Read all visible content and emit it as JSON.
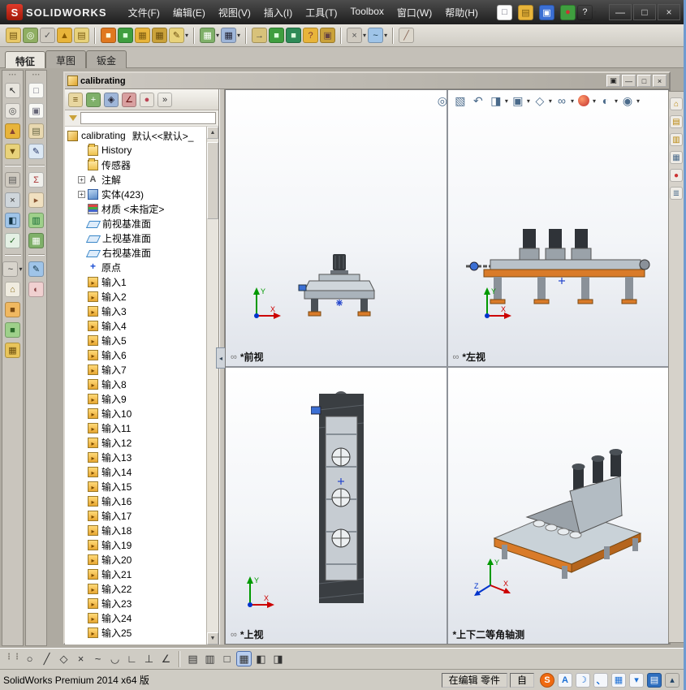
{
  "titlebar": {
    "logo_letter": "S",
    "brand": "SOLIDWORKS",
    "menus": [
      "文件(F)",
      "编辑(E)",
      "视图(V)",
      "插入(I)",
      "工具(T)",
      "Toolbox",
      "窗口(W)",
      "帮助(H)"
    ],
    "tools": [
      {
        "name": "new-document-icon",
        "glyph": "□",
        "bg": "#fdfdfd",
        "fg": "#667",
        "dd": true
      },
      {
        "name": "open-document-icon",
        "glyph": "▤",
        "bg": "#e8b43a",
        "fg": "#7a5a10",
        "dd": true
      },
      {
        "name": "save-icon",
        "glyph": "▣",
        "bg": "#3b6fd4",
        "fg": "#fff",
        "dd": true
      },
      {
        "name": "rebuild-traffic-icon",
        "glyph": "●",
        "bg": "#3f9e3f",
        "fg": "#c33"
      },
      {
        "name": "help-icon",
        "glyph": "?",
        "bg": "transparent",
        "fg": "#eee",
        "dd": true
      }
    ],
    "window_buttons": [
      {
        "name": "app-minimize-button",
        "glyph": "—"
      },
      {
        "name": "app-maximize-button",
        "glyph": "□"
      },
      {
        "name": "app-close-button",
        "glyph": "×"
      }
    ]
  },
  "toolbar2": {
    "items": [
      {
        "name": "print-icon",
        "glyph": "▤",
        "bg": "#e9c867",
        "fg": "#6b4e0e"
      },
      {
        "name": "print-preview-icon",
        "glyph": "◎",
        "bg": "#8fae62",
        "fg": "#fff"
      },
      {
        "name": "spell-check-icon",
        "glyph": "✓",
        "bg": "#cfcac0",
        "fg": "#555"
      },
      {
        "name": "alert-bell-icon",
        "glyph": "▲",
        "bg": "#e8b43a",
        "fg": "#8a5a00"
      },
      {
        "name": "mail-icon",
        "glyph": "▤",
        "bg": "#e8d27a",
        "fg": "#7a5a10"
      },
      {
        "sep": true
      },
      {
        "name": "toolbox-part-1-icon",
        "glyph": "■",
        "bg": "#e07820",
        "fg": "#ffd"
      },
      {
        "name": "toolbox-part-2-icon",
        "glyph": "■",
        "bg": "#3f9e3f",
        "fg": "#dfd"
      },
      {
        "name": "toolbox-part-3-icon",
        "glyph": "▦",
        "bg": "#e8b43a",
        "fg": "#7a5a10"
      },
      {
        "name": "toolbox-part-4-icon",
        "glyph": "▦",
        "bg": "#caa23a",
        "fg": "#6b4e0e"
      },
      {
        "name": "edit-definition-icon",
        "glyph": "✎",
        "bg": "#e8d27a",
        "fg": "#6b4e0e",
        "dd": true
      },
      {
        "sep": true
      },
      {
        "name": "pattern-grid-icon",
        "glyph": "▦",
        "bg": "#7fb069",
        "fg": "#fff",
        "dd": true
      },
      {
        "name": "design-table-icon",
        "glyph": "▦",
        "bg": "#9fb6d9",
        "fg": "#223",
        "dd": true
      },
      {
        "sep": true
      },
      {
        "name": "import-icon",
        "glyph": "→",
        "bg": "#d8c27a",
        "fg": "#444"
      },
      {
        "name": "export-step-icon",
        "glyph": "■",
        "bg": "#3f9e3f",
        "fg": "#dfd"
      },
      {
        "name": "export-iges-icon",
        "glyph": "■",
        "bg": "#2e8b57",
        "fg": "#dfd"
      },
      {
        "name": "check-model-icon",
        "glyph": "?",
        "bg": "#e8b43a",
        "fg": "#733"
      },
      {
        "name": "lock-reference-icon",
        "glyph": "▣",
        "bg": "#caa23a",
        "fg": "#644"
      },
      {
        "sep": true
      },
      {
        "name": "options-icon",
        "glyph": "×",
        "bg": "#cfcac0",
        "fg": "#555",
        "dd": true
      },
      {
        "name": "spline-tools-icon",
        "glyph": "~",
        "bg": "#9fc4e8",
        "fg": "#134",
        "dd": true
      },
      {
        "sep": true
      },
      {
        "name": "measure-icon",
        "glyph": "╱",
        "bg": "#dcd7cc",
        "fg": "#865"
      }
    ]
  },
  "ribbon_tabs": {
    "items": [
      "特征",
      "草图",
      "钣金"
    ],
    "names": [
      "tab-features",
      "tab-sketch",
      "tab-sheetmetal"
    ],
    "active": 0
  },
  "left_rail": {
    "col1": [
      {
        "name": "select-cursor-icon",
        "glyph": "↖",
        "bg": "#e8e5de",
        "fg": "#222"
      },
      {
        "name": "zoom-tool-icon",
        "glyph": "◎",
        "bg": "#e8e5de",
        "fg": "#444"
      },
      {
        "name": "alert-icon",
        "glyph": "▲",
        "bg": "#e8b43a",
        "fg": "#843"
      },
      {
        "name": "filter-tree-icon",
        "glyph": "▼",
        "bg": "#e8d27a",
        "fg": "#6b4e0e"
      },
      {
        "sep": true
      },
      {
        "name": "layers-icon",
        "glyph": "▤",
        "bg": "#cfcac0",
        "fg": "#555"
      },
      {
        "name": "cut-sketch-icon",
        "glyph": "×",
        "bg": "#cfd6db",
        "fg": "#333"
      },
      {
        "name": "paint-appearance-icon",
        "glyph": "◧",
        "bg": "#9fc4e8",
        "fg": "#134"
      },
      {
        "name": "verify-icon",
        "glyph": "✓",
        "bg": "#e4f0e4",
        "fg": "#2a6a2a"
      },
      {
        "sep": true
      },
      {
        "name": "magnet-snap-icon",
        "glyph": "~",
        "bg": "#d8d4cc",
        "fg": "#333",
        "dd": true
      },
      {
        "name": "home-view-icon",
        "glyph": "⌂",
        "bg": "#f0ece0",
        "fg": "#8a6a1a"
      },
      {
        "name": "orange-part-icon",
        "glyph": "■",
        "bg": "#f0b860",
        "fg": "#7a4a12"
      },
      {
        "name": "green-part-icon",
        "glyph": "■",
        "bg": "#9ed08a",
        "fg": "#2a6a2a"
      },
      {
        "name": "pattern-gold-icon",
        "glyph": "▦",
        "bg": "#e8c45a",
        "fg": "#6b4e0e"
      }
    ],
    "col2": [
      {
        "name": "sheet-icon",
        "glyph": "□",
        "bg": "#f8f8f4",
        "fg": "#667"
      },
      {
        "name": "sheet-copy-icon",
        "glyph": "▣",
        "bg": "#f8f8f4",
        "fg": "#667"
      },
      {
        "name": "clipboard-icon",
        "glyph": "▤",
        "bg": "#e8d8b0",
        "fg": "#664"
      },
      {
        "name": "edit-note-icon",
        "glyph": "✎",
        "bg": "#dce8f4",
        "fg": "#236"
      },
      {
        "sep": true
      },
      {
        "name": "equations-icon",
        "glyph": "Σ",
        "bg": "#f0f0ec",
        "fg": "#a33"
      },
      {
        "name": "bookmark-icon",
        "glyph": "▸",
        "bg": "#f0e0c0",
        "fg": "#853"
      },
      {
        "name": "green-book-icon",
        "glyph": "▥",
        "bg": "#9ed08a",
        "fg": "#163"
      },
      {
        "name": "green-book2-icon",
        "glyph": "▦",
        "bg": "#7fb069",
        "fg": "#fff"
      },
      {
        "sep": true
      },
      {
        "name": "blue-brush-icon",
        "glyph": "✎",
        "bg": "#9fc4e8",
        "fg": "#134"
      },
      {
        "name": "palette-icon",
        "glyph": "◐",
        "bg": "#f0d0d0",
        "fg": "#844"
      }
    ]
  },
  "document": {
    "title": "calibrating",
    "buttons": [
      {
        "name": "doc-restore-button",
        "glyph": "▣"
      },
      {
        "name": "doc-minimize-button",
        "glyph": "—"
      },
      {
        "name": "doc-maximize-button",
        "glyph": "□"
      },
      {
        "name": "doc-close-button",
        "glyph": "×"
      }
    ]
  },
  "feature_manager": {
    "tabs": [
      {
        "name": "featuremanager-tab",
        "glyph": "≡",
        "bg": "#e8d7a0",
        "fg": "#6b4e0e"
      },
      {
        "name": "propertymanager-tab",
        "glyph": "+",
        "bg": "#7fb069",
        "fg": "#fff"
      },
      {
        "name": "configurationmanager-tab",
        "glyph": "◈",
        "bg": "#9fb6d9",
        "fg": "#223"
      },
      {
        "name": "dimxpertmanager-tab",
        "glyph": "∠",
        "bg": "#d9a0a0",
        "fg": "#611"
      },
      {
        "name": "displaymanager-tab",
        "glyph": "●",
        "bg": "#e8e4dc",
        "fg": "#b45"
      },
      {
        "name": "fm-tabs-overflow-button",
        "glyph": "»",
        "bg": "transparent",
        "fg": "#333"
      }
    ],
    "filter_value": "",
    "tree": {
      "root_label": "calibrating",
      "root_config": "默认<<默认>_",
      "items": [
        {
          "label": "History",
          "icon": "history"
        },
        {
          "label": "传感器",
          "icon": "sensors"
        },
        {
          "label": "注解",
          "icon": "annotations",
          "expand": true
        },
        {
          "label": "实体(423)",
          "icon": "solids",
          "expand": true
        },
        {
          "label": "材质 <未指定>",
          "icon": "material"
        },
        {
          "label": "前视基准面",
          "icon": "plane"
        },
        {
          "label": "上视基准面",
          "icon": "plane"
        },
        {
          "label": "右视基准面",
          "icon": "plane"
        },
        {
          "label": "原点",
          "icon": "origin"
        },
        {
          "label": "输入1",
          "icon": "imported"
        },
        {
          "label": "输入2",
          "icon": "imported"
        },
        {
          "label": "输入3",
          "icon": "imported"
        },
        {
          "label": "输入4",
          "icon": "imported"
        },
        {
          "label": "输入5",
          "icon": "imported"
        },
        {
          "label": "输入6",
          "icon": "imported"
        },
        {
          "label": "输入7",
          "icon": "imported"
        },
        {
          "label": "输入8",
          "icon": "imported"
        },
        {
          "label": "输入9",
          "icon": "imported"
        },
        {
          "label": "输入10",
          "icon": "imported"
        },
        {
          "label": "输入11",
          "icon": "imported"
        },
        {
          "label": "输入12",
          "icon": "imported"
        },
        {
          "label": "输入13",
          "icon": "imported"
        },
        {
          "label": "输入14",
          "icon": "imported"
        },
        {
          "label": "输入15",
          "icon": "imported"
        },
        {
          "label": "输入16",
          "icon": "imported"
        },
        {
          "label": "输入17",
          "icon": "imported"
        },
        {
          "label": "输入18",
          "icon": "imported"
        },
        {
          "label": "输入19",
          "icon": "imported"
        },
        {
          "label": "输入20",
          "icon": "imported"
        },
        {
          "label": "输入21",
          "icon": "imported"
        },
        {
          "label": "输入22",
          "icon": "imported"
        },
        {
          "label": "输入23",
          "icon": "imported"
        },
        {
          "label": "输入24",
          "icon": "imported"
        },
        {
          "label": "输入25",
          "icon": "imported"
        }
      ]
    }
  },
  "viewport_toolbar": {
    "items": [
      {
        "name": "zoom-fit-icon",
        "glyph": "◎"
      },
      {
        "name": "zoom-area-icon",
        "glyph": "▧"
      },
      {
        "name": "previous-view-icon",
        "glyph": "↶"
      },
      {
        "name": "section-view-icon",
        "glyph": "◨",
        "dd": true
      },
      {
        "name": "view-orientation-icon",
        "glyph": "▣",
        "dd": true
      },
      {
        "name": "display-style-icon",
        "glyph": "◇",
        "dd": true
      },
      {
        "name": "hide-show-items-icon",
        "glyph": "∞",
        "dd": true
      },
      {
        "name": "edit-appearance-icon",
        "glyph": "●",
        "ball": true,
        "dd": true
      },
      {
        "name": "apply-scene-icon",
        "glyph": "◐",
        "dd": true
      },
      {
        "name": "view-settings-icon",
        "glyph": "◉",
        "dd": true
      }
    ]
  },
  "task_pane": {
    "items": [
      {
        "name": "solidworks-resources-icon",
        "glyph": "⌂",
        "fg": "#b8860b"
      },
      {
        "name": "design-library-icon",
        "glyph": "▤",
        "fg": "#b8860b"
      },
      {
        "name": "file-explorer-icon",
        "glyph": "▥",
        "fg": "#b8860b"
      },
      {
        "name": "view-palette-icon",
        "glyph": "▦",
        "fg": "#4a6a8a"
      },
      {
        "name": "appearances-icon",
        "glyph": "●",
        "fg": "#c33"
      },
      {
        "name": "custom-properties-icon",
        "glyph": "≣",
        "fg": "#4a6a8a"
      }
    ]
  },
  "viewports": [
    {
      "label": "*前视",
      "linked": true
    },
    {
      "label": "*左视",
      "linked": true
    },
    {
      "label": "*上视",
      "linked": true
    },
    {
      "label": "*上下二等角轴测",
      "linked": false
    }
  ],
  "triad": {
    "x": "X",
    "y": "Y",
    "z": "Z"
  },
  "bottom_toolbar": {
    "group1": [
      {
        "name": "circle-tool-icon",
        "glyph": "○"
      },
      {
        "name": "line-tool-icon",
        "glyph": "╱"
      },
      {
        "name": "polygon-tool-icon",
        "glyph": "◇"
      },
      {
        "name": "trim-entities-icon",
        "glyph": "×"
      },
      {
        "name": "spline-tool-icon",
        "glyph": "~"
      },
      {
        "name": "arc-tool-icon",
        "glyph": "◡"
      },
      {
        "name": "sketch-fillet-icon",
        "glyph": "∟"
      },
      {
        "name": "perpendicular-relation-icon",
        "glyph": "⊥"
      },
      {
        "name": "smart-dimension-icon",
        "glyph": "∠"
      }
    ],
    "group2": [
      {
        "name": "grid-snap-icon",
        "glyph": "▤"
      },
      {
        "name": "ruler-icon",
        "glyph": "▥"
      },
      {
        "name": "single-viewport-icon",
        "glyph": "□"
      },
      {
        "name": "four-viewport-icon",
        "glyph": "▦",
        "active": true
      },
      {
        "name": "two-viewport-horizontal-icon",
        "glyph": "◧"
      },
      {
        "name": "two-viewport-vertical-icon",
        "glyph": "◨"
      }
    ]
  },
  "statusbar": {
    "left": "SolidWorks Premium 2014 x64 版",
    "editing": "在编辑 零件",
    "custom": "自",
    "icons": [
      {
        "name": "sogou-pinyin-icon",
        "glyph": "S",
        "bg": "#f06a10",
        "fg": "#fff",
        "round": true
      },
      {
        "name": "input-mode-letter-icon",
        "glyph": "A",
        "bg": "#f4f6fa",
        "fg": "#1c6fd4"
      },
      {
        "name": "fullwidth-mode-icon",
        "glyph": "☽",
        "bg": "#f4f6fa",
        "fg": "#1c6fd4"
      },
      {
        "name": "punctuation-mode-icon",
        "glyph": "、",
        "bg": "#f4f6fa",
        "fg": "#1c6fd4"
      },
      {
        "name": "soft-keyboard-icon",
        "glyph": "▦",
        "bg": "#f4f6fa",
        "fg": "#1c6fd4"
      },
      {
        "name": "input-toolbox-icon",
        "glyph": "▾",
        "bg": "#f4f6fa",
        "fg": "#1c6fd4"
      },
      {
        "name": "touch-keyboard-icon",
        "glyph": "▤",
        "bg": "#2f6fbf",
        "fg": "#fff"
      },
      {
        "name": "tray-up-arrow-icon",
        "glyph": "▴",
        "bg": "transparent",
        "fg": "#246"
      }
    ]
  }
}
